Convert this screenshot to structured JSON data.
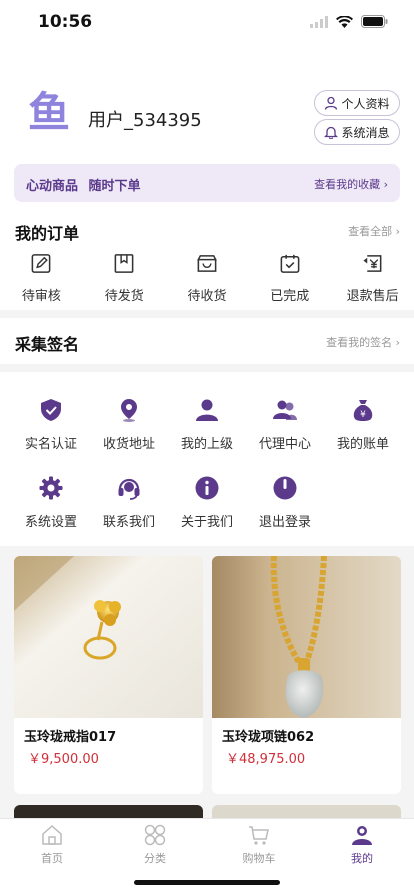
{
  "status": {
    "time": "10:56"
  },
  "profile": {
    "username": "用户_534395",
    "btn_profile": "个人资料",
    "btn_messages": "系统消息"
  },
  "banner": {
    "left": "心动商品 随时下单",
    "right": "查看我的收藏"
  },
  "orders": {
    "title": "我的订单",
    "more": "查看全部",
    "items": [
      {
        "label": "待审核",
        "icon": "pending-review-icon"
      },
      {
        "label": "待发货",
        "icon": "to-ship-icon"
      },
      {
        "label": "待收货",
        "icon": "to-receive-icon"
      },
      {
        "label": "已完成",
        "icon": "completed-icon"
      },
      {
        "label": "退款售后",
        "icon": "refund-icon"
      }
    ]
  },
  "signature": {
    "title": "采集签名",
    "more": "查看我的签名"
  },
  "services": {
    "items": [
      {
        "label": "实名认证",
        "icon": "shield-check-icon"
      },
      {
        "label": "收货地址",
        "icon": "location-pin-icon"
      },
      {
        "label": "我的上级",
        "icon": "user-icon"
      },
      {
        "label": "代理中心",
        "icon": "users-icon"
      },
      {
        "label": "我的账单",
        "icon": "money-bag-icon"
      },
      {
        "label": "系统设置",
        "icon": "gear-icon"
      },
      {
        "label": "联系我们",
        "icon": "headset-icon"
      },
      {
        "label": "关于我们",
        "icon": "info-icon"
      },
      {
        "label": "退出登录",
        "icon": "power-icon"
      }
    ]
  },
  "products": [
    {
      "name": "玉玲珑戒指017",
      "price": "￥9,500.00"
    },
    {
      "name": "玉玲珑项链062",
      "price": "￥48,975.00"
    }
  ],
  "tabbar": {
    "items": [
      {
        "label": "首页",
        "icon": "home-icon"
      },
      {
        "label": "分类",
        "icon": "category-icon"
      },
      {
        "label": "购物车",
        "icon": "cart-icon"
      },
      {
        "label": "我的",
        "icon": "profile-icon"
      }
    ],
    "active_index": 3
  },
  "colors": {
    "accent": "#5b3a8c",
    "price": "#d0303a",
    "banner_bg": "#efe8f6"
  }
}
